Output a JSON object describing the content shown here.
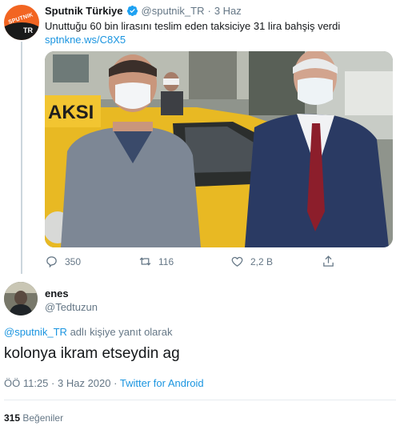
{
  "original_tweet": {
    "author_name": "Sputnik Türkiye",
    "handle": "@sputnik_TR",
    "separator": "·",
    "date": "3 Haz",
    "text": "Unuttuğu 60 bin lirasını teslim eden taksiciye 31 lira bahşiş verdi",
    "link": "sptnkne.ws/C8X5",
    "avatar_logo_text": "SPUTNIK",
    "avatar_logo_sub": "TR",
    "photo_sign_text": "AKSI",
    "actions": {
      "reply_count": "350",
      "retweet_count": "116",
      "like_count": "2,2 B",
      "share_label": ""
    },
    "icons": [
      "verified-icon",
      "reply-icon",
      "retweet-icon",
      "like-icon",
      "share-icon"
    ]
  },
  "reply_tweet": {
    "author_name": "enes",
    "handle": "@Tedtuzun",
    "reply_prefix_mention": "@sputnik_TR",
    "reply_suffix": "adlı kişiye yanıt olarak",
    "text": "kolonya ikram etseydin ag",
    "time": "ÖÖ 11:25",
    "separator": "·",
    "date": "3 Haz 2020",
    "source": "Twitter for Android",
    "likes_count": "315",
    "likes_label": "Beğeniler"
  },
  "colors": {
    "link_blue": "#1b95e0",
    "secondary_text": "#657786",
    "primary_text": "#14171a",
    "sputnik_orange": "#f26522"
  }
}
